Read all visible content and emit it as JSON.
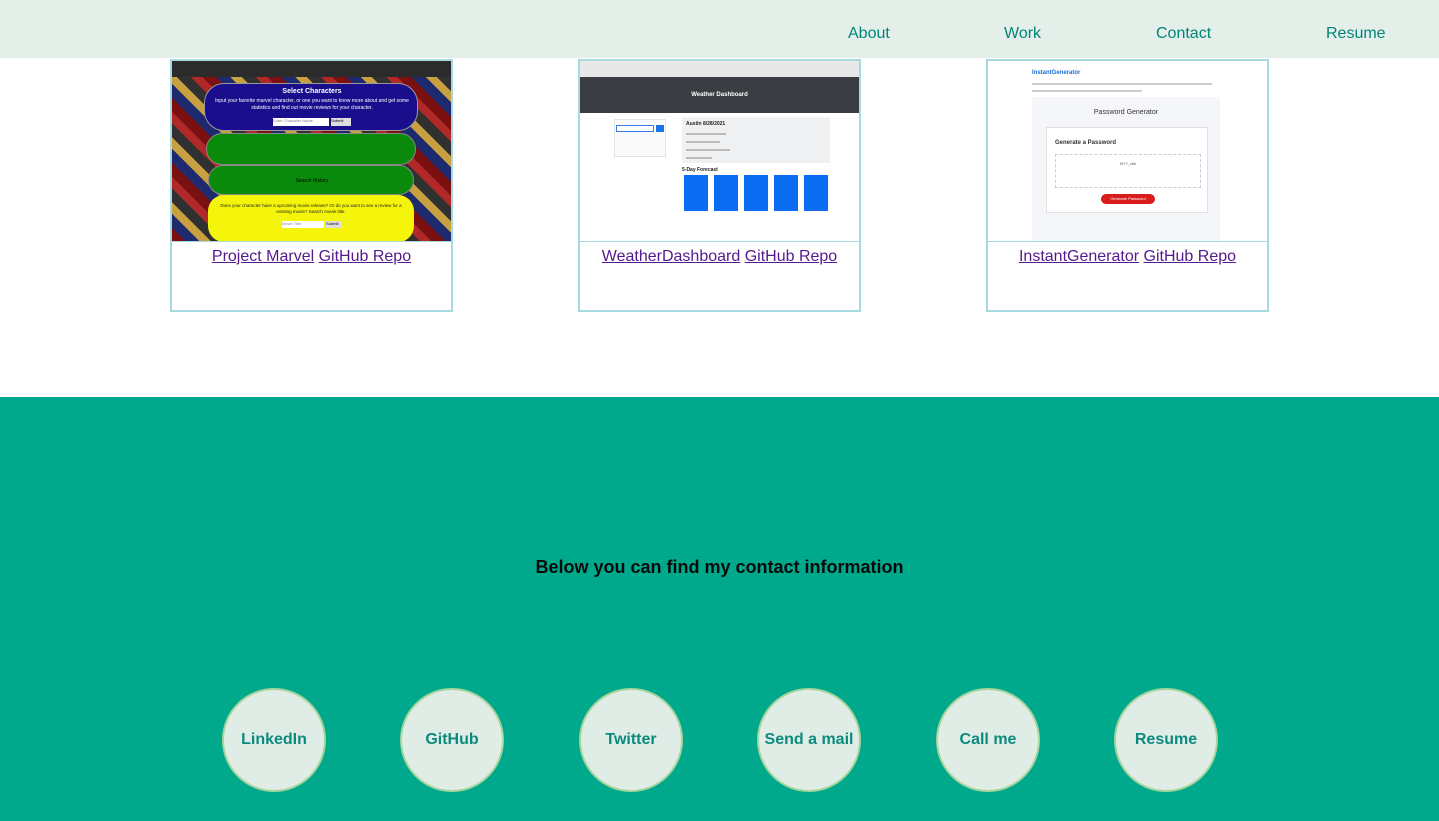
{
  "nav": {
    "items": [
      {
        "label": "About"
      },
      {
        "label": "Work"
      },
      {
        "label": "Contact"
      },
      {
        "label": "Resume"
      }
    ]
  },
  "work": {
    "projects": [
      {
        "name": "Project Marvel",
        "repo_label": "GitHub Repo",
        "screenshot": {
          "heading": "Select Characters",
          "subtext": "Input your favorite marvel character, or one you want to know more about and get some statistics and find out movie reviews for your character.",
          "input_placeholder": "Enter Character Name",
          "button": "Submit",
          "history": "Search History",
          "review_prompt": "Does your character have a upcoming movie release? Or do you want to see a review for a existing movie? Search movie title.",
          "movie_placeholder": "Movie Title",
          "movie_button": "Submit"
        }
      },
      {
        "name": "WeatherDashboard",
        "repo_label": "GitHub Repo",
        "screenshot": {
          "header": "Weather Dashboard",
          "city_heading": "Austin 8/28/2021",
          "forecast_heading": "5-Day Forecast"
        }
      },
      {
        "name": "InstantGenerator",
        "repo_label": "GitHub Repo",
        "screenshot": {
          "title": "InstantGenerator",
          "panel_title": "Password Generator",
          "card_title": "Generate a Password",
          "password": "f3??_z6k",
          "button": "Generate Password"
        }
      }
    ]
  },
  "contact": {
    "heading": "Below you can find my contact information",
    "links": [
      {
        "label": "LinkedIn"
      },
      {
        "label": "GitHub"
      },
      {
        "label": "Twitter"
      },
      {
        "label": "Send a mail"
      },
      {
        "label": "Call me"
      },
      {
        "label": "Resume"
      }
    ]
  },
  "colors": {
    "nav_bg": "#e4efea",
    "accent": "#008577",
    "contact_bg": "#00a98b",
    "circle_bg": "#e0ede6",
    "link_visited": "#551a8b"
  }
}
